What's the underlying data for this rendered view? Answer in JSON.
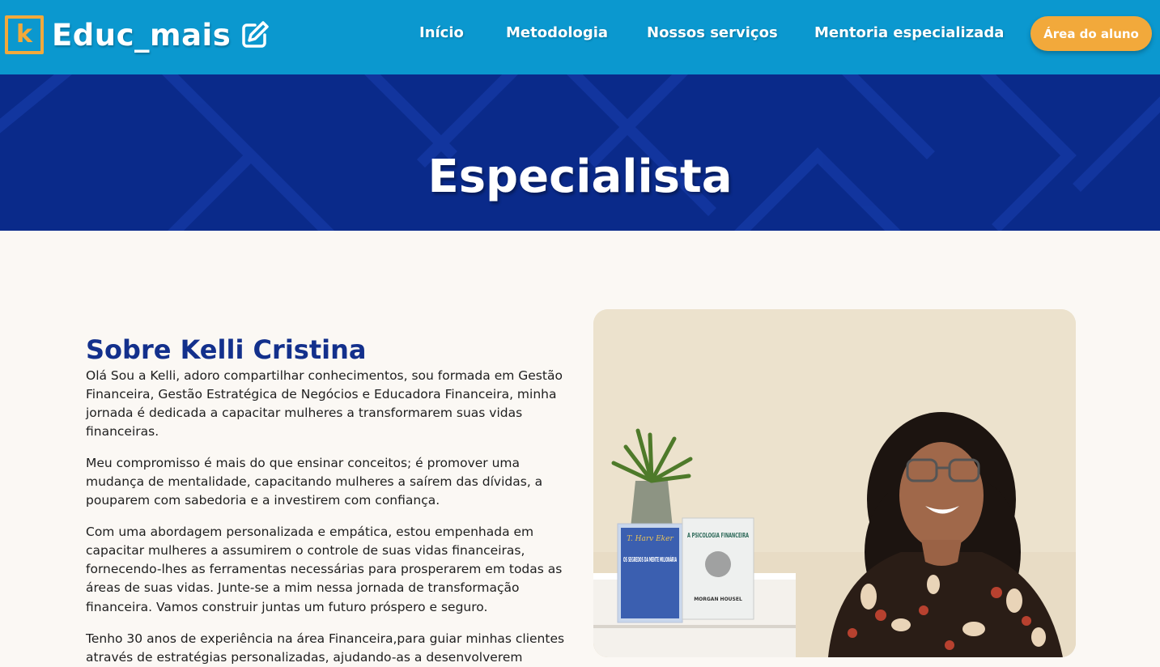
{
  "header": {
    "logo_letter": "k",
    "logo_text": "Educ_mais",
    "logo_icon": "edit-icon",
    "nav": [
      "Início",
      "Metodologia",
      "Nossos serviços",
      "Mentoria especializada"
    ],
    "cta": "Área do aluno"
  },
  "hero": {
    "title": "Especialista"
  },
  "about": {
    "title": "Sobre Kelli Cristina",
    "paragraphs": [
      "Olá Sou a Kelli, adoro compartilhar conhecimentos, sou formada em Gestão Financeira, Gestão Estratégica de Negócios e Educadora Financeira, minha jornada é dedicada a capacitar mulheres a transformarem suas vidas financeiras.",
      "Meu compromisso é mais do que ensinar conceitos; é promover uma mudança de mentalidade, capacitando mulheres a saírem das dívidas, a pouparem com sabedoria e a investirem com confiança.",
      "Com uma abordagem personalizada e empática, estou empenhada em capacitar mulheres a assumirem o controle de suas vidas financeiras, fornecendo-lhes as ferramentas necessárias para prosperarem em todas as áreas de suas vidas. Junte-se a mim nessa jornada de transformação financeira. Vamos construir juntas um futuro próspero e seguro.",
      "Tenho 30 anos de experiência na área Financeira,para guiar minhas clientes através de estratégias personalizadas, ajudando-as a desenvolverem"
    ]
  },
  "photo": {
    "book1_author": "T. Harv Eker",
    "book1_title": "OS SEGREDOS DA MENTE MILIONÁRIA",
    "book2_title": "A PSICOLOGIA FINANCEIRA",
    "book2_author": "MORGAN HOUSEL"
  },
  "colors": {
    "nav_bg": "#0b98cf",
    "accent": "#f2a93b",
    "hero_bg": "#0a2a8a",
    "heading": "#13308c",
    "page_bg": "#fbf8f4"
  }
}
